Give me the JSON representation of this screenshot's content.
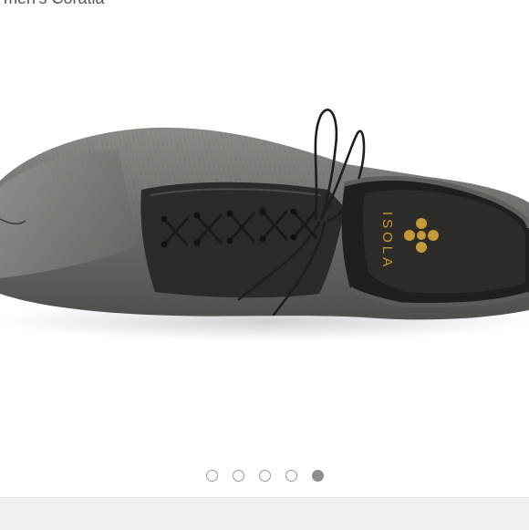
{
  "product": {
    "title": "men's Coratia",
    "brand_mark": "ISOLA",
    "image_alt": "Gray metallic lace-up oxford shoe with black laces"
  },
  "carousel": {
    "slide_count": 5,
    "active_index": 4,
    "dots": [
      {
        "label": "slide 1"
      },
      {
        "label": "slide 2"
      },
      {
        "label": "slide 3"
      },
      {
        "label": "slide 4"
      },
      {
        "label": "slide 5"
      }
    ]
  },
  "colors": {
    "dot_inactive": "#9a9a9a",
    "dot_active": "#8e8e8e",
    "bottom_bar": "#f0f0f0"
  }
}
